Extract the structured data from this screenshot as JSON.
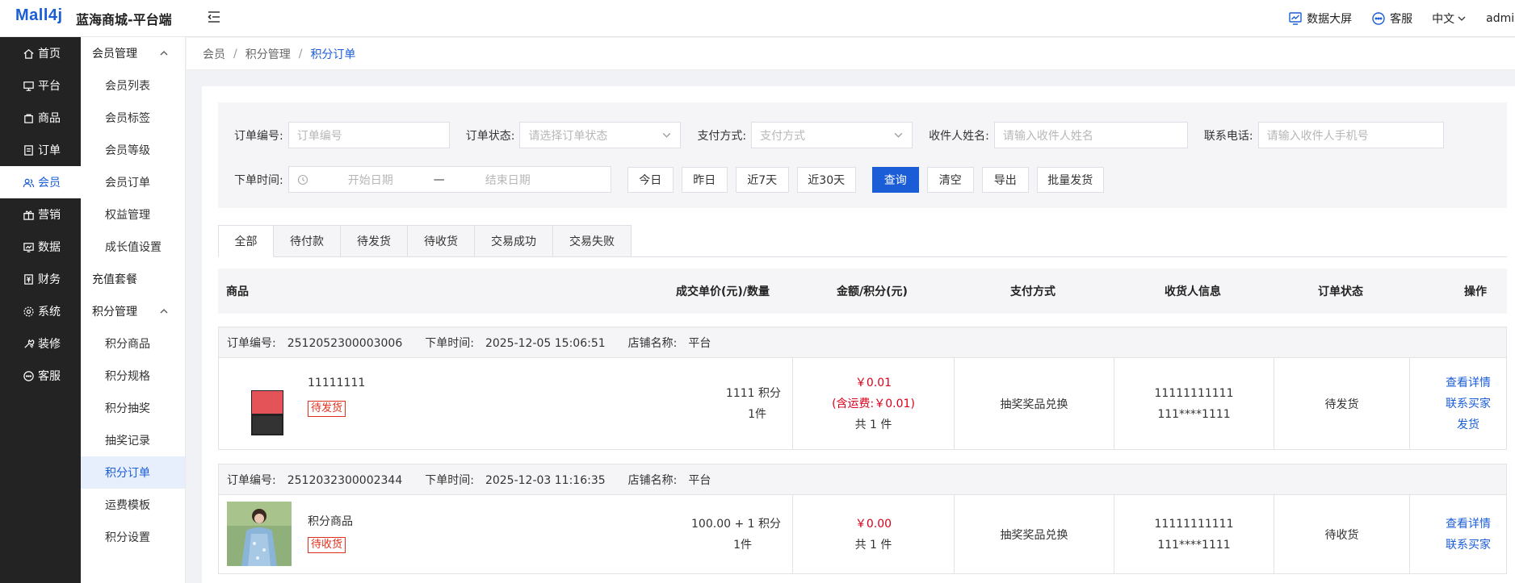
{
  "header": {
    "logo": "Mall4j",
    "title": "蓝海商城-平台端",
    "tools": {
      "dashboard": "数据大屏",
      "service": "客服",
      "lang": "中文",
      "user": "admin"
    }
  },
  "mainnav": [
    {
      "label": "首页"
    },
    {
      "label": "平台"
    },
    {
      "label": "商品"
    },
    {
      "label": "订单"
    },
    {
      "label": "会员"
    },
    {
      "label": "营销"
    },
    {
      "label": "数据"
    },
    {
      "label": "财务"
    },
    {
      "label": "系统"
    },
    {
      "label": "装修"
    },
    {
      "label": "客服"
    }
  ],
  "subnav": {
    "group1": "会员管理",
    "group1_items": [
      "会员列表",
      "会员标签",
      "会员等级",
      "会员订单",
      "权益管理",
      "成长值设置"
    ],
    "single": "充值套餐",
    "group2": "积分管理",
    "group2_items": [
      "积分商品",
      "积分规格",
      "积分抽奖",
      "抽奖记录",
      "积分订单",
      "运费模板",
      "积分设置"
    ]
  },
  "breadcrumb": {
    "l1": "会员",
    "l2": "积分管理",
    "current": "积分订单",
    "sep": "/"
  },
  "filter": {
    "order_no_label": "订单编号:",
    "order_no_ph": "订单编号",
    "status_label": "订单状态:",
    "status_ph": "请选择订单状态",
    "pay_label": "支付方式:",
    "pay_ph": "支付方式",
    "receiver_label": "收件人姓名:",
    "receiver_ph": "请输入收件人姓名",
    "phone_label": "联系电话:",
    "phone_ph": "请输入收件人手机号",
    "time_label": "下单时间:",
    "start_ph": "开始日期",
    "range_sep": "—",
    "end_ph": "结束日期",
    "today": "今日",
    "yesterday": "昨日",
    "d7": "近7天",
    "d30": "近30天",
    "search": "查询",
    "clear": "清空",
    "export": "导出",
    "batch_ship": "批量发货"
  },
  "tabs": [
    "全部",
    "待付款",
    "待发货",
    "待收货",
    "交易成功",
    "交易失败"
  ],
  "columns": {
    "product": "商品",
    "price_qty": "成交单价(元)/数量",
    "amount": "金额/积分(元)",
    "pay": "支付方式",
    "receiver": "收货人信息",
    "status": "订单状态",
    "action": "操作"
  },
  "orders": [
    {
      "no_label": "订单编号:",
      "no": "2512052300003006",
      "time_label": "下单时间:",
      "time": "2025-12-05 15:06:51",
      "shop_label": "店铺名称:",
      "shop": "平台",
      "name": "11111111",
      "tag": "待发货",
      "price": "1111 积分",
      "qty": "1件",
      "amount": "￥0.01",
      "freight": "(含运费:￥0.01)",
      "count": "共 1 件",
      "pay": "抽奖奖品兑换",
      "phone": "11111111111",
      "masked": "111****1111",
      "status": "待发货",
      "actions": [
        "查看详情",
        "联系买家",
        "发货"
      ]
    },
    {
      "no_label": "订单编号:",
      "no": "2512032300002344",
      "time_label": "下单时间:",
      "time": "2025-12-03 11:16:35",
      "shop_label": "店铺名称:",
      "shop": "平台",
      "name": "积分商品",
      "tag": "待收货",
      "price": "100.00 + 1 积分",
      "qty": "1件",
      "amount": "￥0.00",
      "count": "共 1 件",
      "pay": "抽奖奖品兑换",
      "phone": "11111111111",
      "masked": "111****1111",
      "status": "待收货",
      "actions": [
        "查看详情",
        "联系买家"
      ]
    }
  ]
}
